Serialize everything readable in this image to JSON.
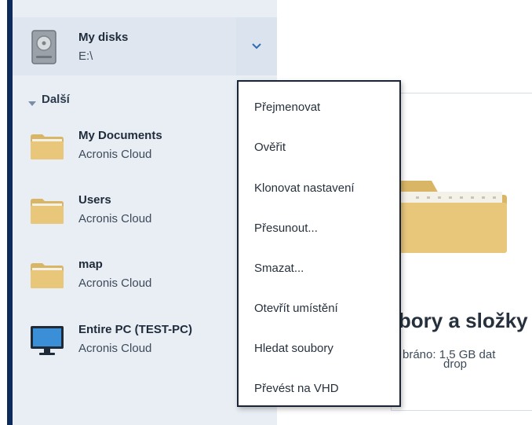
{
  "sidebar": {
    "selected_disk": {
      "name": "My disks",
      "sub": "E:\\"
    },
    "section_label": "Další",
    "items": [
      {
        "name": "My Documents",
        "sub": "Acronis Cloud"
      },
      {
        "name": "Users",
        "sub": "Acronis Cloud"
      },
      {
        "name": "map",
        "sub": "Acronis Cloud"
      },
      {
        "name": "Entire PC (TEST-PC)",
        "sub": "Acronis Cloud"
      }
    ]
  },
  "context_menu": {
    "items": [
      "Přejmenovat",
      "Ověřit",
      "Klonovat nastavení",
      "Přesunout...",
      "Smazat...",
      "Otevřít umístění",
      "Hledat soubory",
      "Převést na VHD"
    ]
  },
  "main": {
    "title": "ubory a složky",
    "sub_line1": "bráno: 1,5 GB dat",
    "sub_line2": "drop"
  },
  "colors": {
    "nav_strip": "#0d2a5a",
    "sidebar_bg": "#e9eef5",
    "folder": "#e8c77b",
    "accent": "#2f6db3"
  }
}
